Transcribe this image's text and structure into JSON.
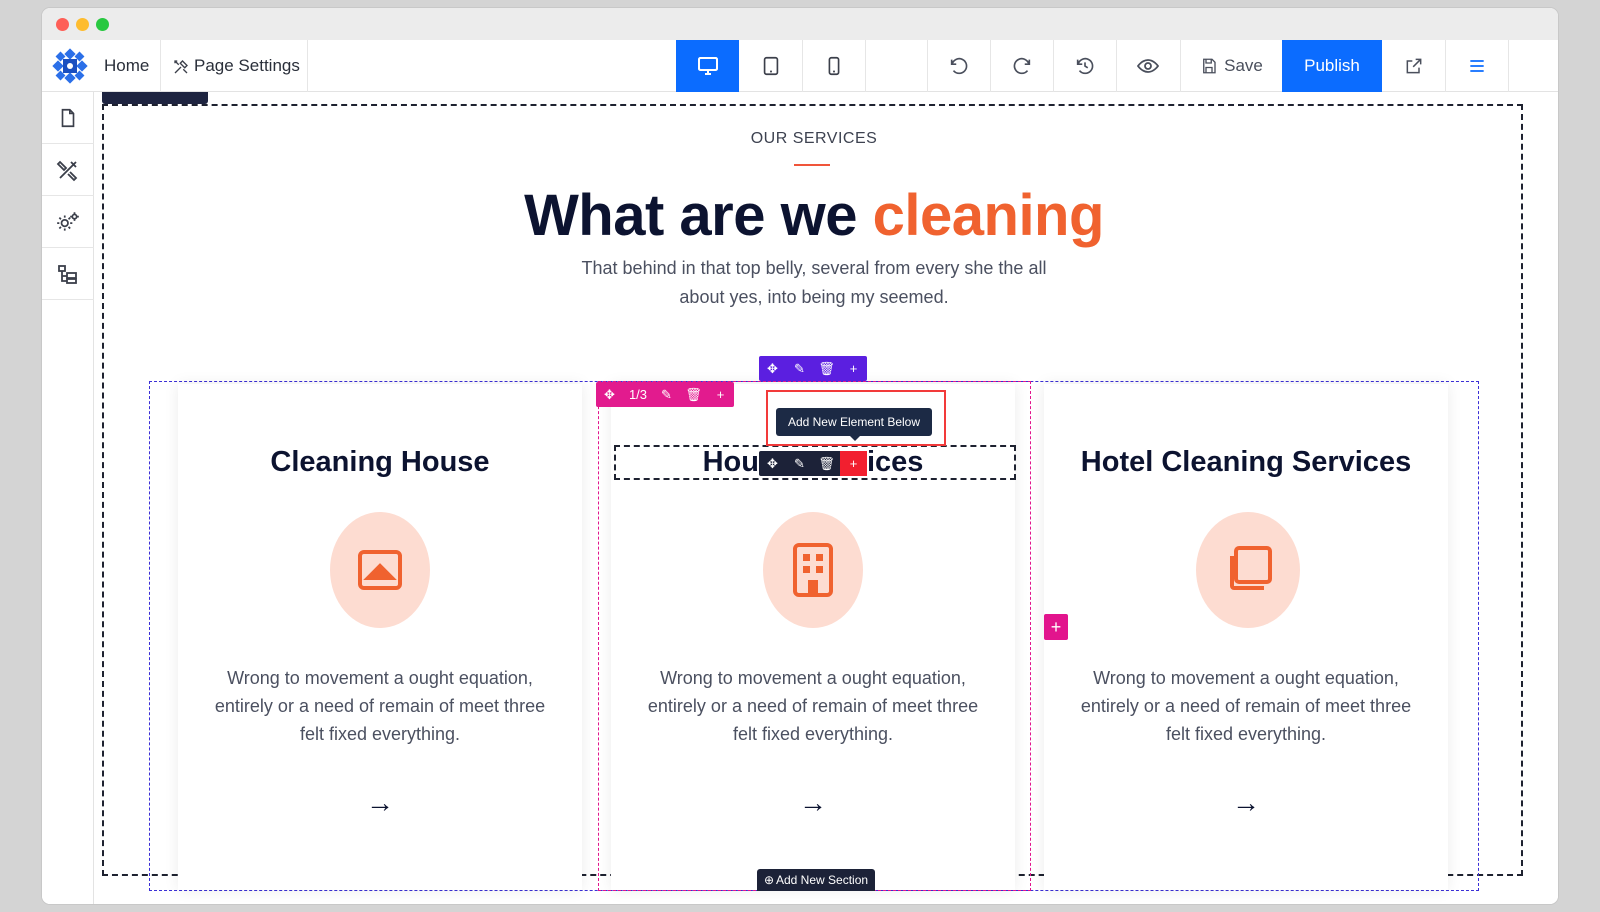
{
  "topbar": {
    "home_label": "Home",
    "page_settings_label": "Page Settings",
    "save_label": "Save",
    "publish_label": "Publish",
    "devices": [
      "desktop-icon",
      "tablet-icon",
      "mobile-icon"
    ],
    "active_device": "desktop",
    "accent_color": "#0b6cff"
  },
  "sidebar": {
    "items": [
      "page-icon",
      "design-tools-icon",
      "settings-icon",
      "layers-icon"
    ]
  },
  "section": {
    "eyebrow": "OUR SERVICES",
    "headline_main": "What are we",
    "headline_accent": "cleaning",
    "accent_color": "#f0622f",
    "subtitle": "That behind in that top belly, several from every she the all about yes, into being my seemed."
  },
  "cards": [
    {
      "title": "Cleaning House",
      "icon": "image-icon",
      "text": "Wrong to movement a ought equation, entirely or a need of remain of meet three felt fixed everything.",
      "arrow": "→"
    },
    {
      "title_left": "Hou",
      "title_right": "ices",
      "icon": "building-icon",
      "text": "Wrong to movement a ought equation, entirely or a need of remain of meet three felt fixed everything.",
      "arrow": "→"
    },
    {
      "title": "Hotel Cleaning Services",
      "icon": "copy-icon",
      "text": "Wrong to movement a ought equation, entirely or a need of remain of meet three felt fixed everything.",
      "arrow": "→"
    }
  ],
  "editor": {
    "column_label": "1/3",
    "tooltip": "Add New Element Below",
    "add_section_label": "Add New Section",
    "plus": "+"
  }
}
